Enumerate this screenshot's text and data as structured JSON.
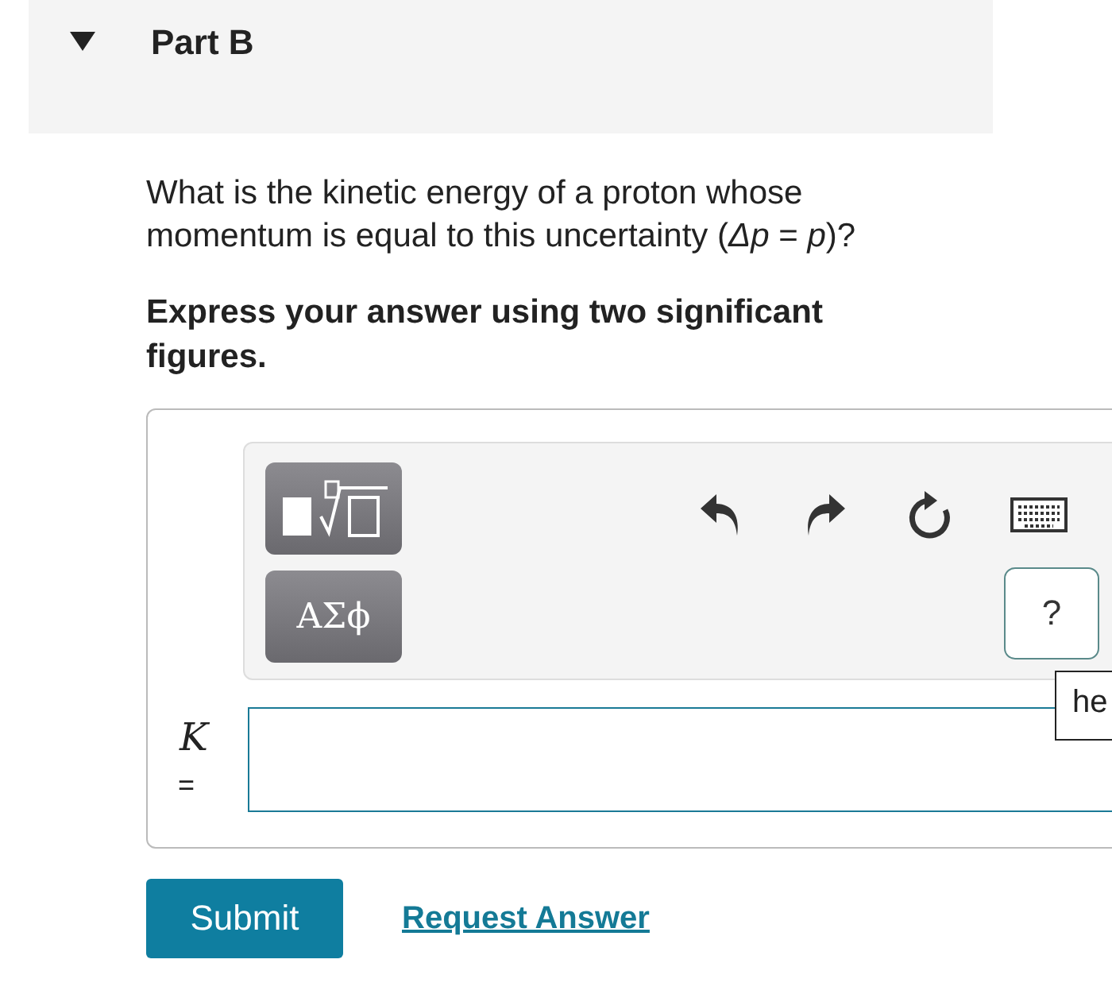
{
  "part": {
    "title": "Part B",
    "expanded": true
  },
  "question": "What is the kinetic energy of a proton whose momentum is equal to this uncertainty (*Δp* = *p*)?",
  "instruction": "Express your answer using two significant figures.",
  "toolbar": {
    "templates_button": {
      "kind": "templates"
    },
    "symbols_button": "ΑΣϕ",
    "help_button": "?",
    "tooltip": "he"
  },
  "answer": {
    "variable": "K",
    "equals": "="
  },
  "buttons": {
    "submit": "Submit",
    "request": "Request Answer"
  }
}
